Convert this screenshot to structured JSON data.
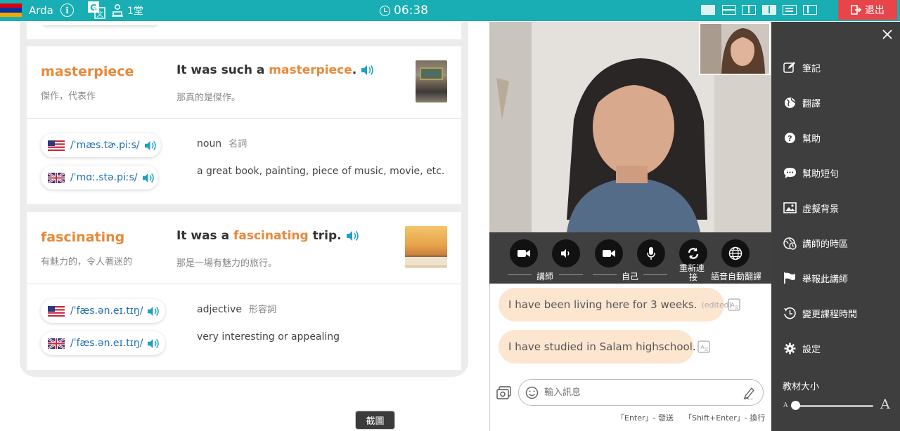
{
  "topbar": {
    "user_name": "Arda",
    "class_count": "1堂",
    "timer": "06:38",
    "exit_label": "退出",
    "colors": {
      "bar": "#19aeb3",
      "exit": "#e8454a"
    }
  },
  "vocab": {
    "words": [
      {
        "word": "masterpiece",
        "meaning": "傑作，代表作",
        "sentence_before": "It was such a ",
        "sentence_word": "masterpiece",
        "sentence_after": ".",
        "sentence_zh": "那真的是傑作。",
        "us_ipa": "/ˈmæs.tɚ.piːs/",
        "uk_ipa": "/ˈmɑː.stə.piːs/",
        "pos": "noun",
        "pos_zh": "名詞",
        "definition": "a great book, painting, piece of music, movie, etc."
      },
      {
        "word": "fascinating",
        "meaning": "有魅力的，令人著迷的",
        "sentence_before": "It was a ",
        "sentence_word": "fascinating",
        "sentence_after": " trip.",
        "sentence_zh": "那是一場有魅力的旅行。",
        "us_ipa": "/ˈfæs.ən.eɪ.tɪŋ/",
        "uk_ipa": "/ˈfæs.ən.eɪ.tɪŋ/",
        "pos": "adjective",
        "pos_zh": "形容詞",
        "definition": "very interesting or appealing"
      }
    ],
    "highlight_color": "#e8893b",
    "screenshot_button": "截圖"
  },
  "video": {
    "controls": {
      "teacher_label": "講師",
      "self_label": "自己",
      "reconnect_label_1": "重新連",
      "reconnect_label_2": "接",
      "auto_translate_label": "語音自動翻譯"
    }
  },
  "chat": {
    "messages": [
      {
        "text": "I have been living here for 3 weeks.",
        "edited": "(edited)"
      },
      {
        "text": "I have studied in Salam highschool.",
        "edited": ""
      }
    ],
    "input_placeholder": "輸入訊息",
    "hint_send": "「Enter」- 發送",
    "hint_newline": "「Shift+Enter」- 換行",
    "bubble_color": "#fde6d0"
  },
  "menu": {
    "items": [
      {
        "label": "筆記",
        "icon": "edit-icon"
      },
      {
        "label": "翻譯",
        "icon": "globe-icon"
      },
      {
        "label": "幫助",
        "icon": "question-icon"
      },
      {
        "label": "幫助短句",
        "icon": "chat-bubble-icon"
      },
      {
        "label": "虛擬背景",
        "icon": "image-icon"
      },
      {
        "label": "講師的時區",
        "icon": "world-clock-icon"
      },
      {
        "label": "舉報此講師",
        "icon": "flag-icon"
      },
      {
        "label": "變更課程時間",
        "icon": "reschedule-icon"
      },
      {
        "label": "設定",
        "icon": "gear-icon"
      }
    ],
    "font_size_label": "教材大小",
    "font_size_small": "A",
    "font_size_large": "A",
    "font_size_level": 0.03
  }
}
